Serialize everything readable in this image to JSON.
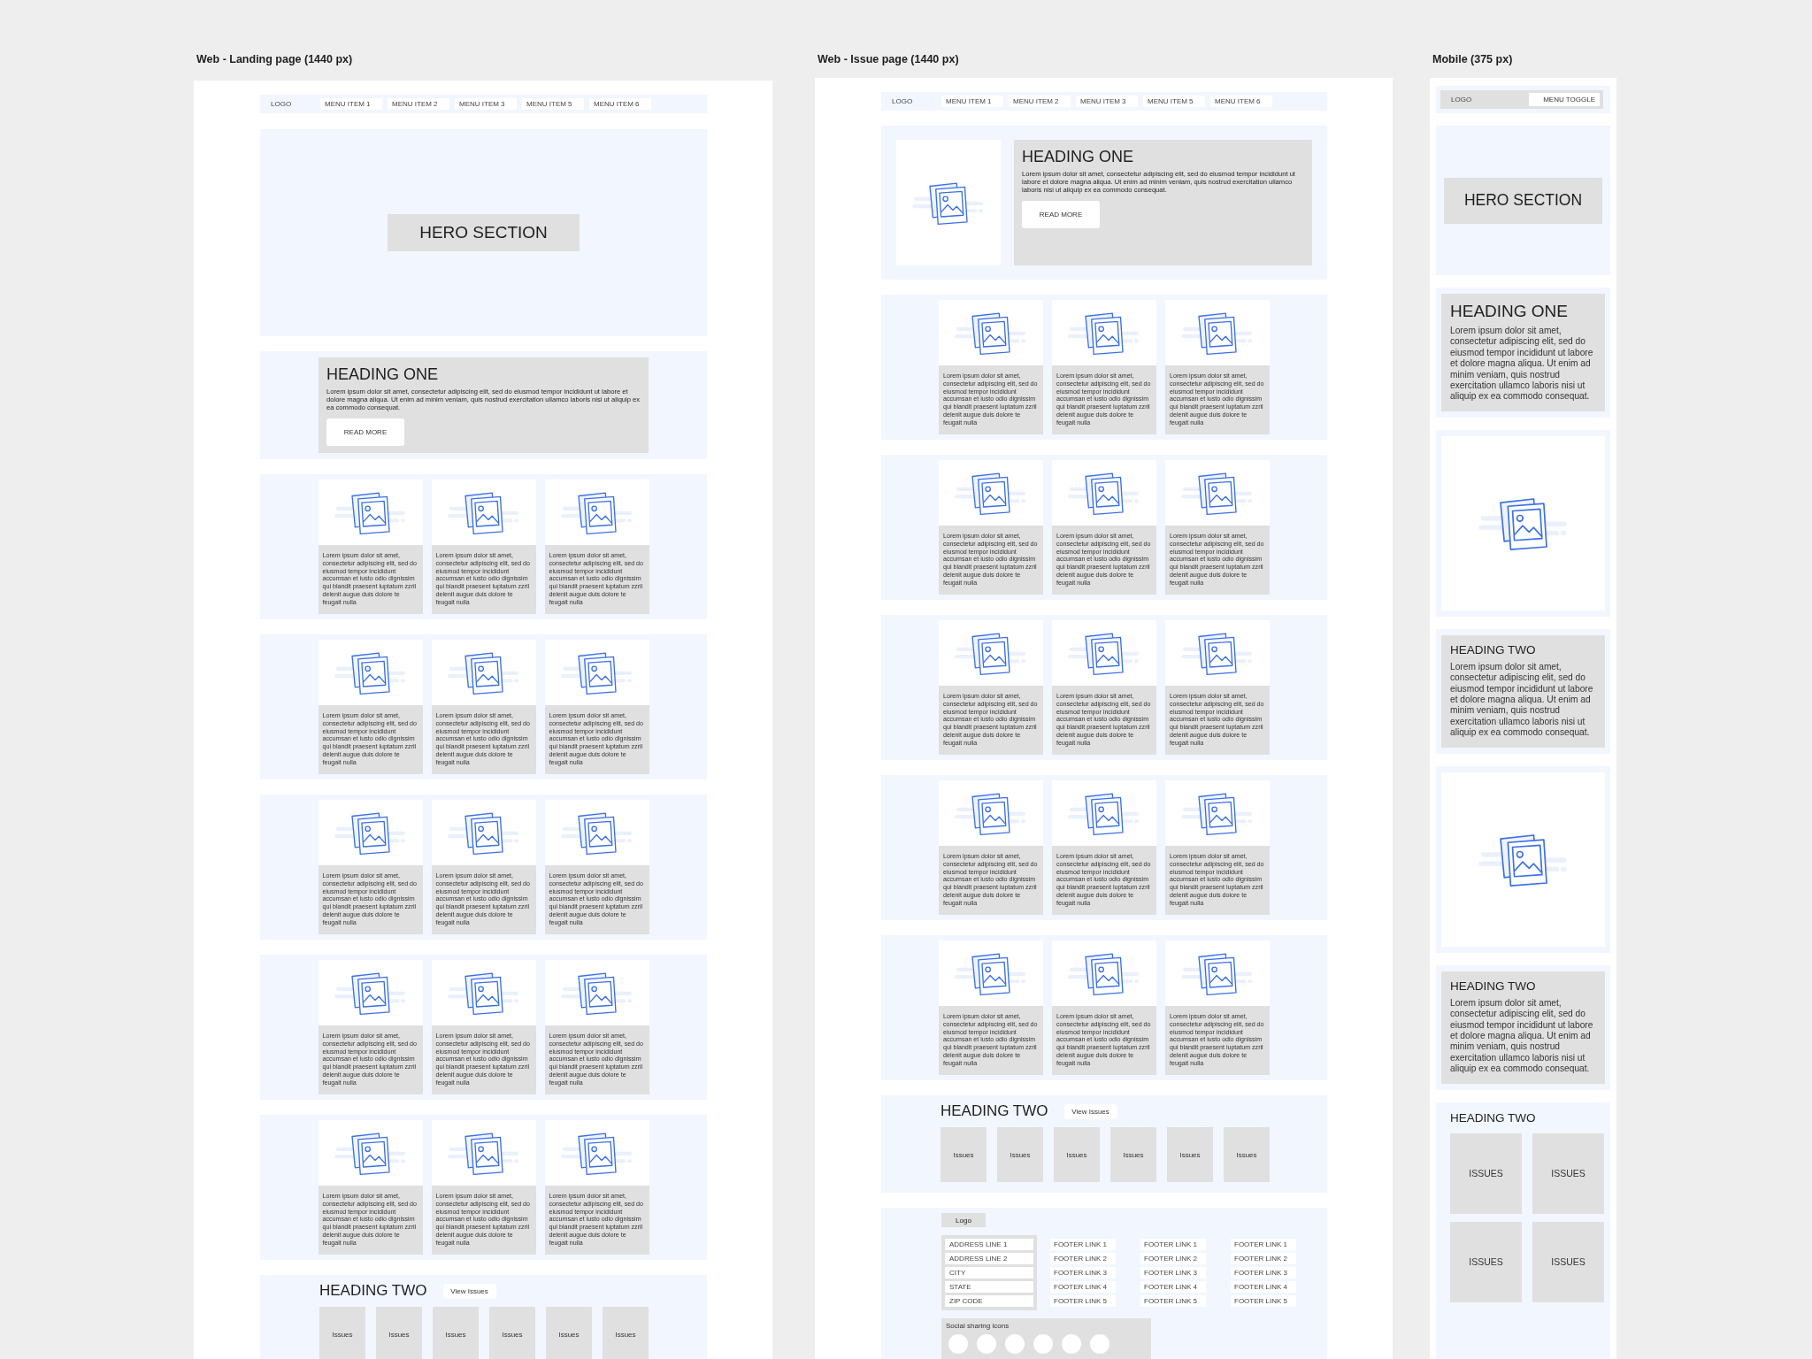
{
  "landing_page": {
    "title": "Web - Landing page (1440 px)",
    "nav": {
      "logo": "LOGO",
      "items": [
        "MENU ITEM 1",
        "MENU ITEM 2",
        "MENU ITEM 3",
        "MENU ITEM 5",
        "MENU ITEM 6"
      ]
    },
    "hero": "HERO SECTION",
    "feature": {
      "heading": "HEADING ONE",
      "text": "Lorem ipsum dolor sit amet, consectetur adipiscing elit, sed do eiusmod tempor incididunt ut labore et dolore magna aliqua. Ut enim ad minim veniam, quis nostrud exercitation ullamco laboris nisi ut aliquip ex ea commodo consequat.",
      "button": "READ MORE"
    },
    "card_rows": [
      [
        "Lorem ipsum dolor sit amet, consectetur adipiscing elit, sed do eiusmod tempor incididunt accumsan et iusto odio dignissim qui blandit praesent luptatum zzril delenit augue duis dolore te feugait nulla",
        "Lorem ipsum dolor sit amet, consectetur adipiscing elit, sed do eiusmod tempor incididunt accumsan et iusto odio dignissim qui blandit praesent luptatum zzril delenit augue duis dolore te feugait nulla",
        "Lorem ipsum dolor sit amet, consectetur adipiscing elit, sed do eiusmod tempor incididunt accumsan et iusto odio dignissim qui blandit praesent luptatum zzril delenit augue duis dolore te feugait nulla"
      ],
      [
        "Lorem ipsum dolor sit amet, consectetur adipiscing elit, sed do eiusmod tempor incididunt accumsan et iusto odio dignissim qui blandit praesent luptatum zzril delenit augue duis dolore te feugait nulla",
        "Lorem ipsum dolor sit amet, consectetur adipiscing elit, sed do eiusmod tempor incididunt accumsan et iusto odio dignissim qui blandit praesent luptatum zzril delenit augue duis dolore te feugait nulla",
        "Lorem ipsum dolor sit amet, consectetur adipiscing elit, sed do eiusmod tempor incididunt accumsan et iusto odio dignissim qui blandit praesent luptatum zzril delenit augue duis dolore te feugait nulla"
      ],
      [
        "Lorem ipsum dolor sit amet, consectetur adipiscing elit, sed do eiusmod tempor incididunt accumsan et iusto odio dignissim qui blandit praesent luptatum zzril delenit augue duis dolore te feugait nulla",
        "Lorem ipsum dolor sit amet, consectetur adipiscing elit, sed do eiusmod tempor incididunt accumsan et iusto odio dignissim qui blandit praesent luptatum zzril delenit augue duis dolore te feugait nulla",
        "Lorem ipsum dolor sit amet, consectetur adipiscing elit, sed do eiusmod tempor incididunt accumsan et iusto odio dignissim qui blandit praesent luptatum zzril delenit augue duis dolore te feugait nulla"
      ],
      [
        "Lorem ipsum dolor sit amet, consectetur adipiscing elit, sed do eiusmod tempor incididunt accumsan et iusto odio dignissim qui blandit praesent luptatum zzril delenit augue duis dolore te feugait nulla",
        "Lorem ipsum dolor sit amet, consectetur adipiscing elit, sed do eiusmod tempor incididunt accumsan et iusto odio dignissim qui blandit praesent luptatum zzril delenit augue duis dolore te feugait nulla",
        "Lorem ipsum dolor sit amet, consectetur adipiscing elit, sed do eiusmod tempor incididunt accumsan et iusto odio dignissim qui blandit praesent luptatum zzril delenit augue duis dolore te feugait nulla"
      ],
      [
        "Lorem ipsum dolor sit amet, consectetur adipiscing elit, sed do eiusmod tempor incididunt accumsan et iusto odio dignissim qui blandit praesent luptatum zzril delenit augue duis dolore te feugait nulla",
        "Lorem ipsum dolor sit amet, consectetur adipiscing elit, sed do eiusmod tempor incididunt accumsan et iusto odio dignissim qui blandit praesent luptatum zzril delenit augue duis dolore te feugait nulla",
        "Lorem ipsum dolor sit amet, consectetur adipiscing elit, sed do eiusmod tempor incididunt accumsan et iusto odio dignissim qui blandit praesent luptatum zzril delenit augue duis dolore te feugait nulla"
      ]
    ],
    "issues": {
      "heading": "HEADING TWO",
      "button": "View Issues",
      "tiles": [
        "Issues",
        "Issues",
        "Issues",
        "Issues",
        "Issues",
        "Issues"
      ]
    }
  },
  "issue_page": {
    "title": "Web - Issue page (1440 px)",
    "nav": {
      "logo": "LOGO",
      "items": [
        "MENU ITEM 1",
        "MENU ITEM 2",
        "MENU ITEM 3",
        "MENU ITEM 5",
        "MENU ITEM 6"
      ]
    },
    "feature": {
      "heading": "HEADING ONE",
      "text": "Lorem ipsum dolor sit amet, consectetur adipiscing elit, sed do eiusmod tempor incididunt ut labore et dolore magna aliqua. Ut enim ad minim veniam, quis nostrud exercitation ullamco laboris nisi ut aliquip ex ea commodo consequat.",
      "button": "READ MORE"
    },
    "card_rows": [
      [
        "Lorem ipsum dolor sit amet, consectetur adipiscing elit, sed do eiusmod tempor incididunt accumsan et iusto odio dignissim qui blandit praesent luptatum zzril delenit augue duis dolore te feugait nulla",
        "Lorem ipsum dolor sit amet, consectetur adipiscing elit, sed do eiusmod tempor incididunt accumsan et iusto odio dignissim qui blandit praesent luptatum zzril delenit augue duis dolore te feugait nulla",
        "Lorem ipsum dolor sit amet, consectetur adipiscing elit, sed do eiusmod tempor incididunt accumsan et iusto odio dignissim qui blandit praesent luptatum zzril delenit augue duis dolore te feugait nulla"
      ],
      [
        "Lorem ipsum dolor sit amet, consectetur adipiscing elit, sed do eiusmod tempor incididunt accumsan et iusto odio dignissim qui blandit praesent luptatum zzril delenit augue duis dolore te feugait nulla",
        "Lorem ipsum dolor sit amet, consectetur adipiscing elit, sed do eiusmod tempor incididunt accumsan et iusto odio dignissim qui blandit praesent luptatum zzril delenit augue duis dolore te feugait nulla",
        "Lorem ipsum dolor sit amet, consectetur adipiscing elit, sed do eiusmod tempor incididunt accumsan et iusto odio dignissim qui blandit praesent luptatum zzril delenit augue duis dolore te feugait nulla"
      ],
      [
        "Lorem ipsum dolor sit amet, consectetur adipiscing elit, sed do eiusmod tempor incididunt accumsan et iusto odio dignissim qui blandit praesent luptatum zzril delenit augue duis dolore te feugait nulla",
        "Lorem ipsum dolor sit amet, consectetur adipiscing elit, sed do eiusmod tempor incididunt accumsan et iusto odio dignissim qui blandit praesent luptatum zzril delenit augue duis dolore te feugait nulla",
        "Lorem ipsum dolor sit amet, consectetur adipiscing elit, sed do eiusmod tempor incididunt accumsan et iusto odio dignissim qui blandit praesent luptatum zzril delenit augue duis dolore te feugait nulla"
      ],
      [
        "Lorem ipsum dolor sit amet, consectetur adipiscing elit, sed do eiusmod tempor incididunt accumsan et iusto odio dignissim qui blandit praesent luptatum zzril delenit augue duis dolore te feugait nulla",
        "Lorem ipsum dolor sit amet, consectetur adipiscing elit, sed do eiusmod tempor incididunt accumsan et iusto odio dignissim qui blandit praesent luptatum zzril delenit augue duis dolore te feugait nulla",
        "Lorem ipsum dolor sit amet, consectetur adipiscing elit, sed do eiusmod tempor incididunt accumsan et iusto odio dignissim qui blandit praesent luptatum zzril delenit augue duis dolore te feugait nulla"
      ],
      [
        "Lorem ipsum dolor sit amet, consectetur adipiscing elit, sed do eiusmod tempor incididunt accumsan et iusto odio dignissim qui blandit praesent luptatum zzril delenit augue duis dolore te feugait nulla",
        "Lorem ipsum dolor sit amet, consectetur adipiscing elit, sed do eiusmod tempor incididunt accumsan et iusto odio dignissim qui blandit praesent luptatum zzril delenit augue duis dolore te feugait nulla",
        "Lorem ipsum dolor sit amet, consectetur adipiscing elit, sed do eiusmod tempor incididunt accumsan et iusto odio dignissim qui blandit praesent luptatum zzril delenit augue duis dolore te feugait nulla"
      ]
    ],
    "issues": {
      "heading": "HEADING TWO",
      "button": "View Issues",
      "tiles": [
        "Issues",
        "Issues",
        "Issues",
        "Issues",
        "Issues",
        "Issues"
      ]
    },
    "footer": {
      "logo": "Logo",
      "address_fields": [
        "ADDRESS LINE 1",
        "ADDRESS LINE 2",
        "CITY",
        "STATE",
        "ZIP CODE"
      ],
      "link_columns": [
        [
          "FOOTER LINK 1",
          "FOOTER LINK 2",
          "FOOTER LINK 3",
          "FOOTER LINK 4",
          "FOOTER LINK 5"
        ],
        [
          "FOOTER LINK 1",
          "FOOTER LINK 2",
          "FOOTER LINK 3",
          "FOOTER LINK 4",
          "FOOTER LINK 5"
        ],
        [
          "FOOTER LINK 1",
          "FOOTER LINK 2",
          "FOOTER LINK 3",
          "FOOTER LINK 4",
          "FOOTER LINK 5"
        ]
      ],
      "social_label": "Social sharing icons"
    }
  },
  "mobile": {
    "title": "Mobile (375 px)",
    "nav": {
      "logo": "LOGO",
      "toggle": "MENU TOGGLE"
    },
    "sections": [
      {
        "kind": "hero",
        "label": "HERO SECTION"
      },
      {
        "kind": "text",
        "heading": "HEADING ONE",
        "text": "Lorem ipsum dolor sit amet, consectetur adipiscing elit, sed do eiusmod tempor incididunt ut labore et dolore magna aliqua. Ut enim ad minim veniam, quis nostrud exercitation ullamco laboris nisi ut aliquip ex ea commodo consequat."
      },
      {
        "kind": "image"
      },
      {
        "kind": "subtext",
        "heading": "HEADING TWO",
        "text": "Lorem ipsum dolor sit amet, consectetur adipiscing elit, sed do eiusmod tempor incididunt ut labore et dolore magna aliqua. Ut enim ad minim veniam, quis nostrud exercitation ullamco laboris nisi ut aliquip ex ea commodo consequat."
      },
      {
        "kind": "image"
      },
      {
        "kind": "subtext",
        "heading": "HEADING TWO",
        "text": "Lorem ipsum dolor sit amet, consectetur adipiscing elit, sed do eiusmod tempor incididunt ut labore et dolore magna aliqua. Ut enim ad minim veniam, quis nostrud exercitation ullamco laboris nisi ut aliquip ex ea commodo consequat."
      },
      {
        "kind": "issues",
        "heading": "HEADING TWO",
        "tiles": [
          "ISSUES",
          "ISSUES",
          "ISSUES",
          "ISSUES"
        ]
      }
    ]
  }
}
